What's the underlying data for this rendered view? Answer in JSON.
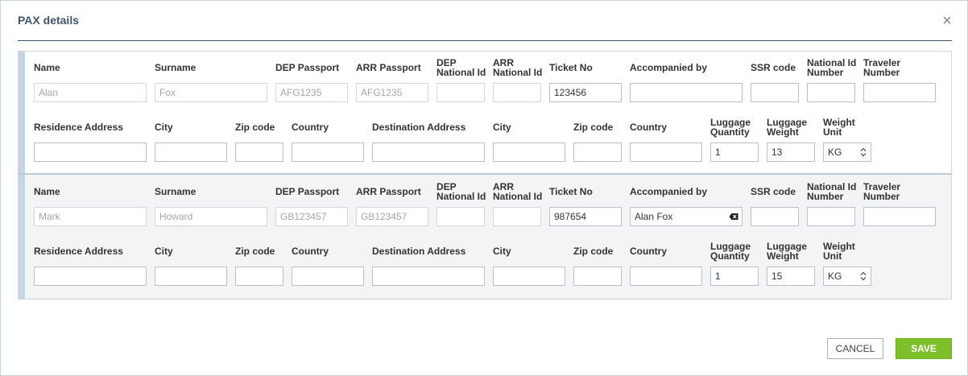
{
  "dialog": {
    "title": "PAX details",
    "close_glyph": "×"
  },
  "labels": {
    "name": "Name",
    "surname": "Surname",
    "dep_passport": "DEP Passport",
    "arr_passport": "ARR Passport",
    "dep_national_id_1": "DEP",
    "dep_national_id_2": "National Id",
    "arr_national_id_1": "ARR",
    "arr_national_id_2": "National Id",
    "ticket_no": "Ticket No",
    "accompanied_by": "Accompanied by",
    "ssr_code": "SSR code",
    "national_id_number_1": "National Id",
    "national_id_number_2": "Number",
    "traveler_number_1": "Traveler",
    "traveler_number_2": "Number",
    "residence_address": "Residence Address",
    "city": "City",
    "zip_code": "Zip code",
    "country": "Country",
    "destination_address": "Destination Address",
    "luggage_quantity_1": "Luggage",
    "luggage_quantity_2": "Quantity",
    "luggage_weight_1": "Luggage",
    "luggage_weight_2": "Weight",
    "weight_unit_1": "Weight",
    "weight_unit_2": "Unit"
  },
  "passengers": [
    {
      "name": "Alan",
      "surname": "Fox",
      "dep_passport": "AFG1235",
      "arr_passport": "AFG1235",
      "dep_national_id": "",
      "arr_national_id": "",
      "ticket_no": "123456",
      "accompanied_by": "",
      "ssr_code": "",
      "national_id_number": "",
      "traveler_number": "",
      "residence_address": "",
      "residence_city": "",
      "residence_zip": "",
      "residence_country": "",
      "destination_address": "",
      "destination_city": "",
      "destination_zip": "",
      "destination_country": "",
      "luggage_quantity": "1",
      "luggage_weight": "13",
      "weight_unit": "KG"
    },
    {
      "name": "Mark",
      "surname": "Howard",
      "dep_passport": "GB123457",
      "arr_passport": "GB123457",
      "dep_national_id": "",
      "arr_national_id": "",
      "ticket_no": "987654",
      "accompanied_by": "Alan Fox",
      "ssr_code": "",
      "national_id_number": "",
      "traveler_number": "",
      "residence_address": "",
      "residence_city": "",
      "residence_zip": "",
      "residence_country": "",
      "destination_address": "",
      "destination_city": "",
      "destination_zip": "",
      "destination_country": "",
      "luggage_quantity": "1",
      "luggage_weight": "15",
      "weight_unit": "KG"
    }
  ],
  "footer": {
    "cancel_label": "CANCEL",
    "save_label": "SAVE"
  },
  "colors": {
    "title": "#3d5570",
    "save_button": "#7cc12a",
    "second_block_background": "#f3f4f6"
  },
  "icons": {
    "close": "close-icon",
    "clear": "backspace-clear-icon",
    "select_arrows": "updown-arrows-icon"
  }
}
